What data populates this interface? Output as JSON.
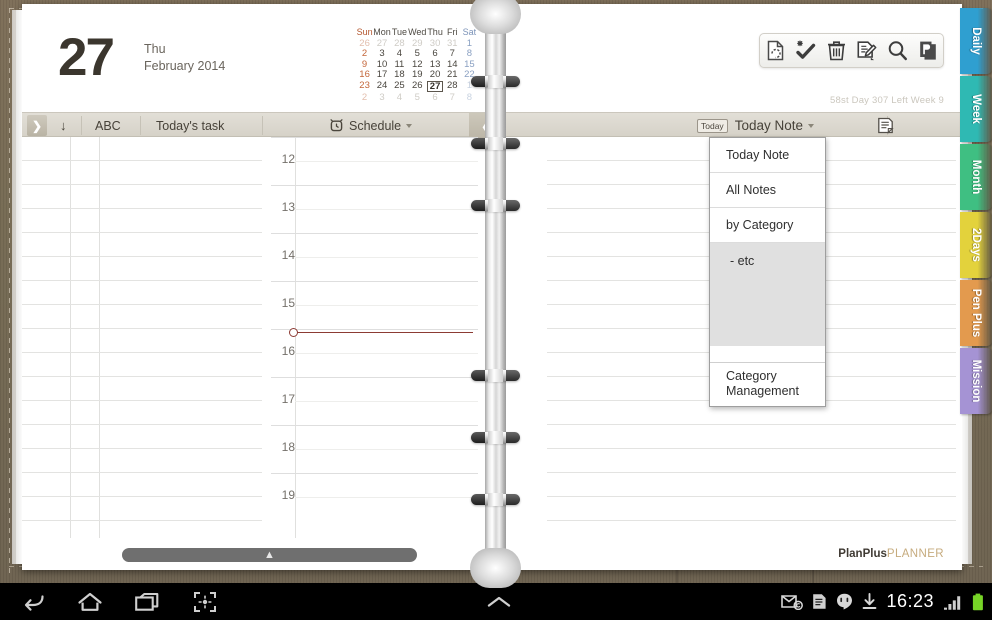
{
  "date": {
    "day": "27",
    "weekday": "Thu",
    "monthyear": "February 2014"
  },
  "minicalendar": {
    "weekday_headers": [
      "Sun",
      "Mon",
      "Tue",
      "Wed",
      "Thu",
      "Fri",
      "Sat"
    ],
    "weeks": [
      [
        {
          "d": "26",
          "out": true
        },
        {
          "d": "27",
          "out": true
        },
        {
          "d": "28",
          "out": true
        },
        {
          "d": "29",
          "out": true
        },
        {
          "d": "30",
          "out": true
        },
        {
          "d": "31",
          "out": true
        },
        {
          "d": "1",
          "out": false
        }
      ],
      [
        {
          "d": "2",
          "out": false
        },
        {
          "d": "3",
          "out": false
        },
        {
          "d": "4",
          "out": false
        },
        {
          "d": "5",
          "out": false
        },
        {
          "d": "6",
          "out": false
        },
        {
          "d": "7",
          "out": false
        },
        {
          "d": "8",
          "out": false
        }
      ],
      [
        {
          "d": "9",
          "out": false
        },
        {
          "d": "10",
          "out": false
        },
        {
          "d": "11",
          "out": false
        },
        {
          "d": "12",
          "out": false
        },
        {
          "d": "13",
          "out": false
        },
        {
          "d": "14",
          "out": false
        },
        {
          "d": "15",
          "out": false
        }
      ],
      [
        {
          "d": "16",
          "out": false
        },
        {
          "d": "17",
          "out": false
        },
        {
          "d": "18",
          "out": false
        },
        {
          "d": "19",
          "out": false
        },
        {
          "d": "20",
          "out": false
        },
        {
          "d": "21",
          "out": false
        },
        {
          "d": "22",
          "out": false
        }
      ],
      [
        {
          "d": "23",
          "out": false
        },
        {
          "d": "24",
          "out": false
        },
        {
          "d": "25",
          "out": false
        },
        {
          "d": "26",
          "out": false
        },
        {
          "d": "27",
          "out": false,
          "today": true
        },
        {
          "d": "28",
          "out": false
        },
        {
          "d": "1",
          "out": true
        }
      ],
      [
        {
          "d": "2",
          "out": true
        },
        {
          "d": "3",
          "out": true
        },
        {
          "d": "4",
          "out": true
        },
        {
          "d": "5",
          "out": true
        },
        {
          "d": "6",
          "out": true
        },
        {
          "d": "7",
          "out": true
        },
        {
          "d": "8",
          "out": true
        }
      ]
    ]
  },
  "toolbar": {
    "icons": [
      {
        "name": "copy-page-icon",
        "label": "Copy"
      },
      {
        "name": "check-done-icon",
        "label": "Done"
      },
      {
        "name": "trash-icon",
        "label": "Delete"
      },
      {
        "name": "edit-note-icon",
        "label": "Edit"
      },
      {
        "name": "search-icon",
        "label": "Search"
      },
      {
        "name": "planner-app-icon",
        "label": "P"
      }
    ]
  },
  "status_line": "58st Day 307 Left Week 9",
  "section_bar": {
    "expand_arrow": "❯",
    "sort_icon": "↓",
    "abc_label": "ABC",
    "task_label": "Today's task",
    "schedule_label": "Schedule",
    "collapse_arrow": "❮",
    "today_badge": "Today",
    "note_label": "Today Note",
    "note_icon": "note-page-icon"
  },
  "schedule": {
    "hours": [
      "12",
      "13",
      "14",
      "15",
      "16",
      "17",
      "18",
      "19"
    ],
    "now_indicator": {
      "visible": true,
      "time": "15:45"
    }
  },
  "dropdown": {
    "items": [
      {
        "label": "Today Note",
        "selected": false,
        "sub": false
      },
      {
        "label": "All Notes",
        "selected": false,
        "sub": false
      },
      {
        "label": "by Category",
        "selected": false,
        "sub": false
      },
      {
        "label": "- etc",
        "selected": true,
        "sub": true
      }
    ],
    "footer": "Category Management"
  },
  "side_tabs": [
    {
      "label": "Daily",
      "color": "#2f9fd0"
    },
    {
      "label": "Week",
      "color": "#2fb9b3"
    },
    {
      "label": "Month",
      "color": "#3fbf82"
    },
    {
      "label": "2Days",
      "color": "#e3d23c"
    },
    {
      "label": "Pen Plus",
      "color": "#e39a4e"
    },
    {
      "label": "Mission",
      "color": "#a593d4"
    }
  ],
  "footer": {
    "handle_icon": "chevron-up-icon",
    "logo_primary": "PlanPlus",
    "logo_secondary": "PLANNER"
  },
  "system_bar": {
    "nav": [
      {
        "name": "back-button",
        "glyph": "back-icon"
      },
      {
        "name": "home-button",
        "glyph": "home-icon"
      },
      {
        "name": "recents-button",
        "glyph": "recents-icon"
      },
      {
        "name": "screenshot-button",
        "glyph": "screenshot-icon"
      }
    ],
    "tray": [
      {
        "name": "email-icon"
      },
      {
        "name": "document-icon"
      },
      {
        "name": "hangouts-icon"
      },
      {
        "name": "download-icon"
      }
    ],
    "clock": "16:23",
    "signal": "signal-icon",
    "battery": "battery-icon"
  },
  "colors": {
    "accent_now": "#8c3b34",
    "bar": "#dcd8cf",
    "desk": "#756a53",
    "logo_gold": "#c6ab7e"
  }
}
